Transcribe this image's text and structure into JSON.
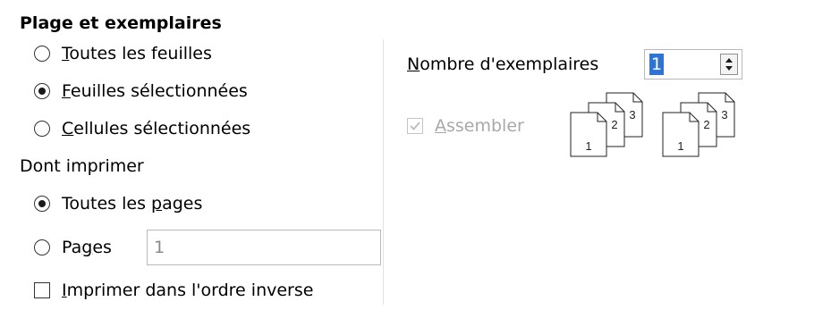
{
  "range": {
    "title": "Plage et exemplaires",
    "options": [
      {
        "mnemonic": "T",
        "rest": "outes les feuilles",
        "selected": false
      },
      {
        "mnemonic": "F",
        "rest": "euilles sélectionnées",
        "selected": true
      },
      {
        "mnemonic": "C",
        "rest": "ellules sélectionnées",
        "selected": false
      }
    ]
  },
  "print_scope": {
    "title": "Dont imprimer",
    "all_pages": {
      "before": "Toutes les ",
      "mnemonic": "p",
      "after": "ages",
      "selected": true
    },
    "pages": {
      "before": "Pa",
      "mnemonic": "g",
      "after": "es",
      "selected": false,
      "value": "1"
    },
    "reverse": {
      "mnemonic": "I",
      "rest": "mprimer dans l'ordre inverse",
      "checked": false
    }
  },
  "copies": {
    "label_mnemonic": "N",
    "label_rest": "ombre d'exemplaires",
    "value": "1",
    "collate": {
      "mnemonic": "A",
      "rest": "ssembler",
      "checked": true,
      "enabled": false
    }
  },
  "collate_preview": {
    "pages": [
      "1",
      "2",
      "3"
    ]
  },
  "colors": {
    "selection": "#2f74d0",
    "disabled": "#a8a8a8",
    "border": "#b9b9b9"
  }
}
